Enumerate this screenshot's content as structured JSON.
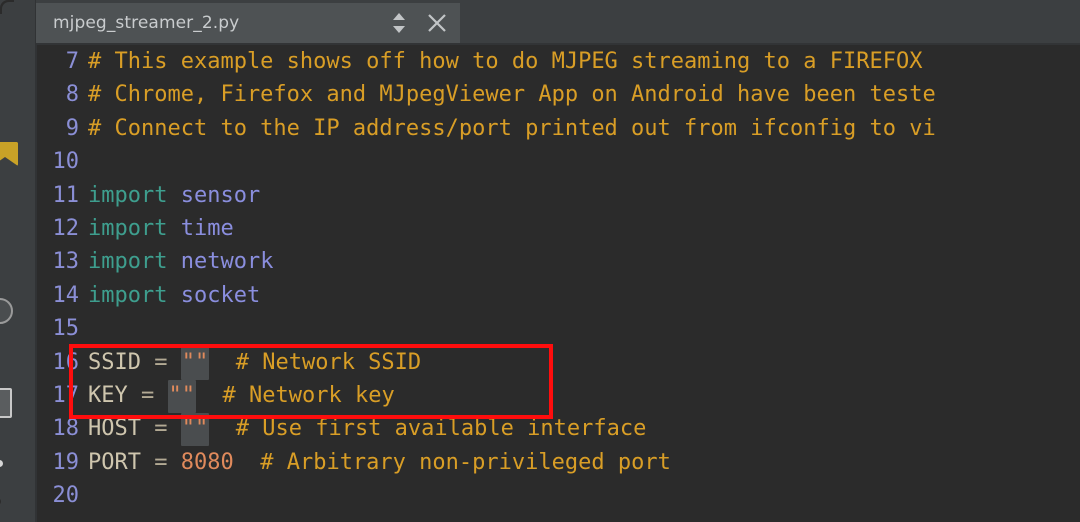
{
  "window": {
    "app_kind": "code-editor"
  },
  "toolstrip": {
    "icons": [
      {
        "name": "bookmark-icon"
      },
      {
        "name": "circle-button-icon"
      },
      {
        "name": "panel-toggle-icon"
      },
      {
        "name": "dot-indicator-icon"
      },
      {
        "name": "dot-indicator-icon-2"
      }
    ]
  },
  "tabbar": {
    "tab": {
      "label": "mjpeg_streamer_2.py",
      "stepper_icon": "up-down-arrows-icon",
      "close_icon": "close-x-icon"
    }
  },
  "editor": {
    "lines": [
      {
        "number": "7",
        "tokens": [
          {
            "text": "# This example shows off how to do MJPEG streaming to a FIREFOX",
            "kind": "comment"
          }
        ]
      },
      {
        "number": "8",
        "tokens": [
          {
            "text": "# Chrome, Firefox and MJpegViewer App on Android have been teste",
            "kind": "comment"
          }
        ]
      },
      {
        "number": "9",
        "tokens": [
          {
            "text": "# Connect to the IP address/port printed out from ifconfig to vi",
            "kind": "comment"
          }
        ]
      },
      {
        "number": "10",
        "tokens": []
      },
      {
        "number": "11",
        "tokens": [
          {
            "text": "import",
            "kind": "kw"
          },
          {
            "text": " ",
            "kind": "plain"
          },
          {
            "text": "sensor",
            "kind": "mod"
          }
        ]
      },
      {
        "number": "12",
        "tokens": [
          {
            "text": "import",
            "kind": "kw"
          },
          {
            "text": " ",
            "kind": "plain"
          },
          {
            "text": "time",
            "kind": "mod"
          }
        ]
      },
      {
        "number": "13",
        "tokens": [
          {
            "text": "import",
            "kind": "kw"
          },
          {
            "text": " ",
            "kind": "plain"
          },
          {
            "text": "network",
            "kind": "mod"
          }
        ]
      },
      {
        "number": "14",
        "tokens": [
          {
            "text": "import",
            "kind": "kw"
          },
          {
            "text": " ",
            "kind": "plain"
          },
          {
            "text": "socket",
            "kind": "mod"
          }
        ]
      },
      {
        "number": "15",
        "tokens": []
      },
      {
        "number": "16",
        "tokens": [
          {
            "text": "SSID",
            "kind": "var"
          },
          {
            "text": " = ",
            "kind": "op"
          },
          {
            "text": "\"\"",
            "kind": "str-highlight"
          },
          {
            "text": "  ",
            "kind": "plain"
          },
          {
            "text": "# Network SSID",
            "kind": "comment"
          }
        ]
      },
      {
        "number": "17",
        "tokens": [
          {
            "text": "KEY",
            "kind": "var"
          },
          {
            "text": " = ",
            "kind": "op"
          },
          {
            "text": "\"\"",
            "kind": "str-highlight"
          },
          {
            "text": "  ",
            "kind": "plain"
          },
          {
            "text": "# Network key",
            "kind": "comment"
          }
        ]
      },
      {
        "number": "18",
        "tokens": [
          {
            "text": "HOST",
            "kind": "var"
          },
          {
            "text": " = ",
            "kind": "op"
          },
          {
            "text": "\"\"",
            "kind": "str-highlight"
          },
          {
            "text": "  ",
            "kind": "plain"
          },
          {
            "text": "# Use first available interface",
            "kind": "comment"
          }
        ]
      },
      {
        "number": "19",
        "tokens": [
          {
            "text": "PORT",
            "kind": "var"
          },
          {
            "text": " = ",
            "kind": "op"
          },
          {
            "text": "8080",
            "kind": "num"
          },
          {
            "text": "  ",
            "kind": "plain"
          },
          {
            "text": "# Arbitrary non-privileged port",
            "kind": "comment"
          }
        ]
      },
      {
        "number": "20",
        "tokens": []
      }
    ]
  },
  "annotation": {
    "kind": "red-rectangle-highlight",
    "covers_lines": [
      "16",
      "17"
    ],
    "color": "#ff0d0d"
  },
  "colors": {
    "editor_background": "#2b2b2b",
    "chrome_background": "#3c3f41",
    "tab_active_background": "#4e5254",
    "line_number": "#8b8fd6",
    "comment": "#d99e26",
    "keyword": "#3e9e8e",
    "module": "#8a8ede",
    "variable": "#cfc6ae",
    "number_literal": "#e08a5c",
    "occurrence_highlight": "#4a4d4f",
    "annotation_red": "#ff0d0d"
  }
}
